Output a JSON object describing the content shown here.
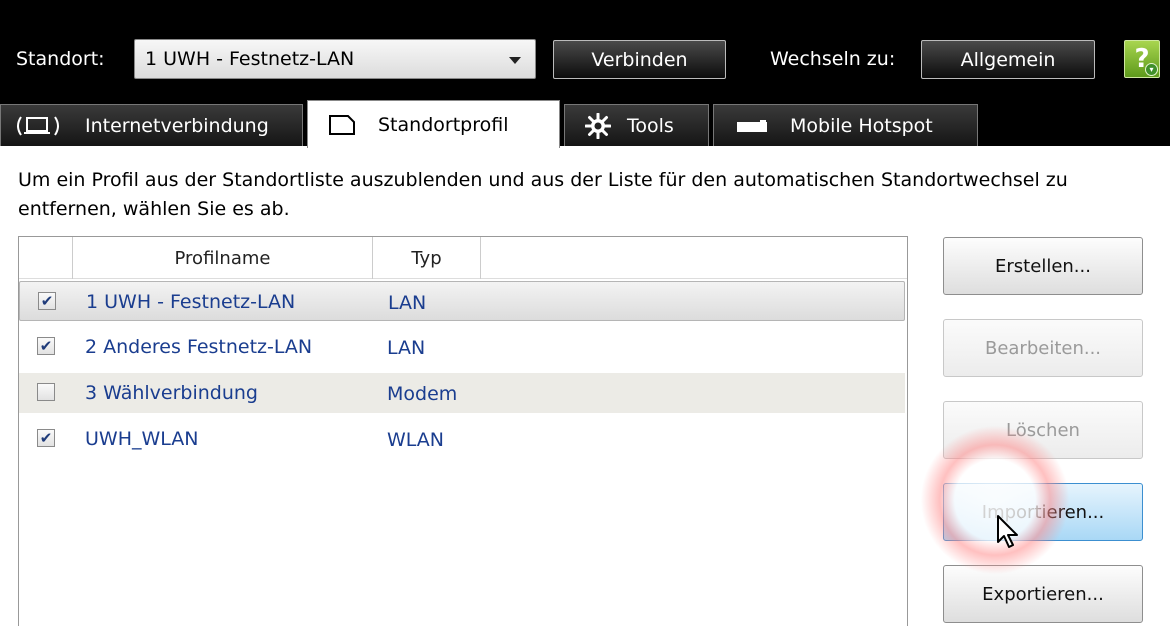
{
  "header": {
    "location_label": "Standort:",
    "location_value": "1 UWH - Festnetz-LAN",
    "connect_label": "Verbinden",
    "switch_label": "Wechseln zu:",
    "switch_value": "Allgemein",
    "help_glyph": "?"
  },
  "tabs": [
    {
      "label": "Internetverbindung",
      "icon": "network-icon",
      "active": false
    },
    {
      "label": "Standortprofil",
      "icon": "profile-icon",
      "active": true
    },
    {
      "label": "Tools",
      "icon": "gear-icon",
      "active": false
    },
    {
      "label": "Mobile Hotspot",
      "icon": "hotspot-icon",
      "active": false
    }
  ],
  "description": "Um ein Profil aus der Standortliste auszublenden und aus der Liste für den automatischen Standortwechsel zu entfernen, wählen Sie es ab.",
  "table": {
    "columns": [
      "Profilname",
      "Typ"
    ],
    "rows": [
      {
        "checked": true,
        "check_glyph": "✔",
        "name": "1 UWH - Festnetz-LAN",
        "type": "LAN"
      },
      {
        "checked": true,
        "check_glyph": "✔",
        "name": "2 Anderes Festnetz-LAN",
        "type": "LAN"
      },
      {
        "checked": false,
        "check_glyph": "",
        "name": "3 Wählverbindung",
        "type": "Modem"
      },
      {
        "checked": true,
        "check_glyph": "✔",
        "name": "UWH_WLAN",
        "type": "WLAN"
      }
    ]
  },
  "buttons": {
    "create": "Erstellen...",
    "edit": "Bearbeiten...",
    "delete": "Löschen",
    "import": "Importieren...",
    "export": "Exportieren..."
  },
  "colors": {
    "row_text": "#1a3d8f",
    "accent_blue": "#3c8fd0",
    "help_green": "#6cad22"
  }
}
